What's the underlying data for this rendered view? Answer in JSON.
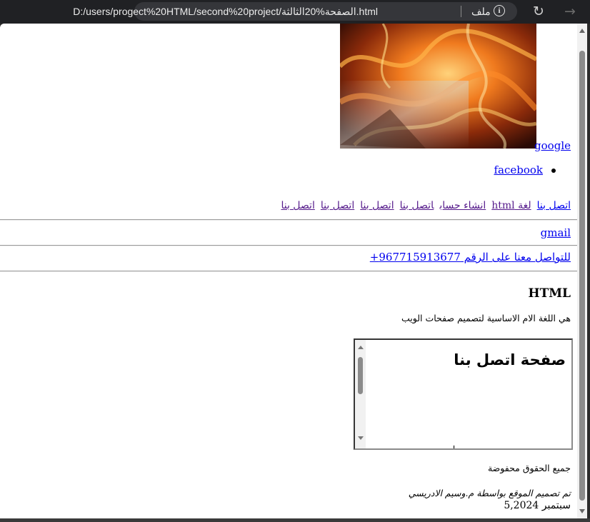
{
  "browser": {
    "url": "D:/users/progect%20HTML/second%20project/الصفحة%20الثالثة.html",
    "file_label": "ملف",
    "info_icon": "info-icon",
    "reload_icon": "reload-icon",
    "forward_icon": "forward-icon"
  },
  "page": {
    "hero_image": "fire-photo",
    "google_link": "google",
    "facebook_link": "facebook",
    "nav_links": [
      "اتصل بنا",
      "لغة html",
      "انشاء حساب",
      "اتصل بنا",
      "اتصل بنا",
      "اتصل بنا",
      "اتصل بنا"
    ],
    "gmail_link": "gmail",
    "phone_link": "للتواصل معنا على الرقم 967715913677+",
    "heading": "HTML",
    "description": "هي اللغة الام الاساسية لتصميم صفحات الويب",
    "iframe_title": "صفحة اتصل بنا",
    "rights": "جميع الحقوق محفوضة",
    "credit": "تم تصميم الموقع بواسطة م.وسيم الادريسي",
    "date": "سبتمبر 5,2024"
  },
  "colors": {
    "link": "#0000ee",
    "visited_link": "#551a8b",
    "chrome_bg": "#202124"
  }
}
